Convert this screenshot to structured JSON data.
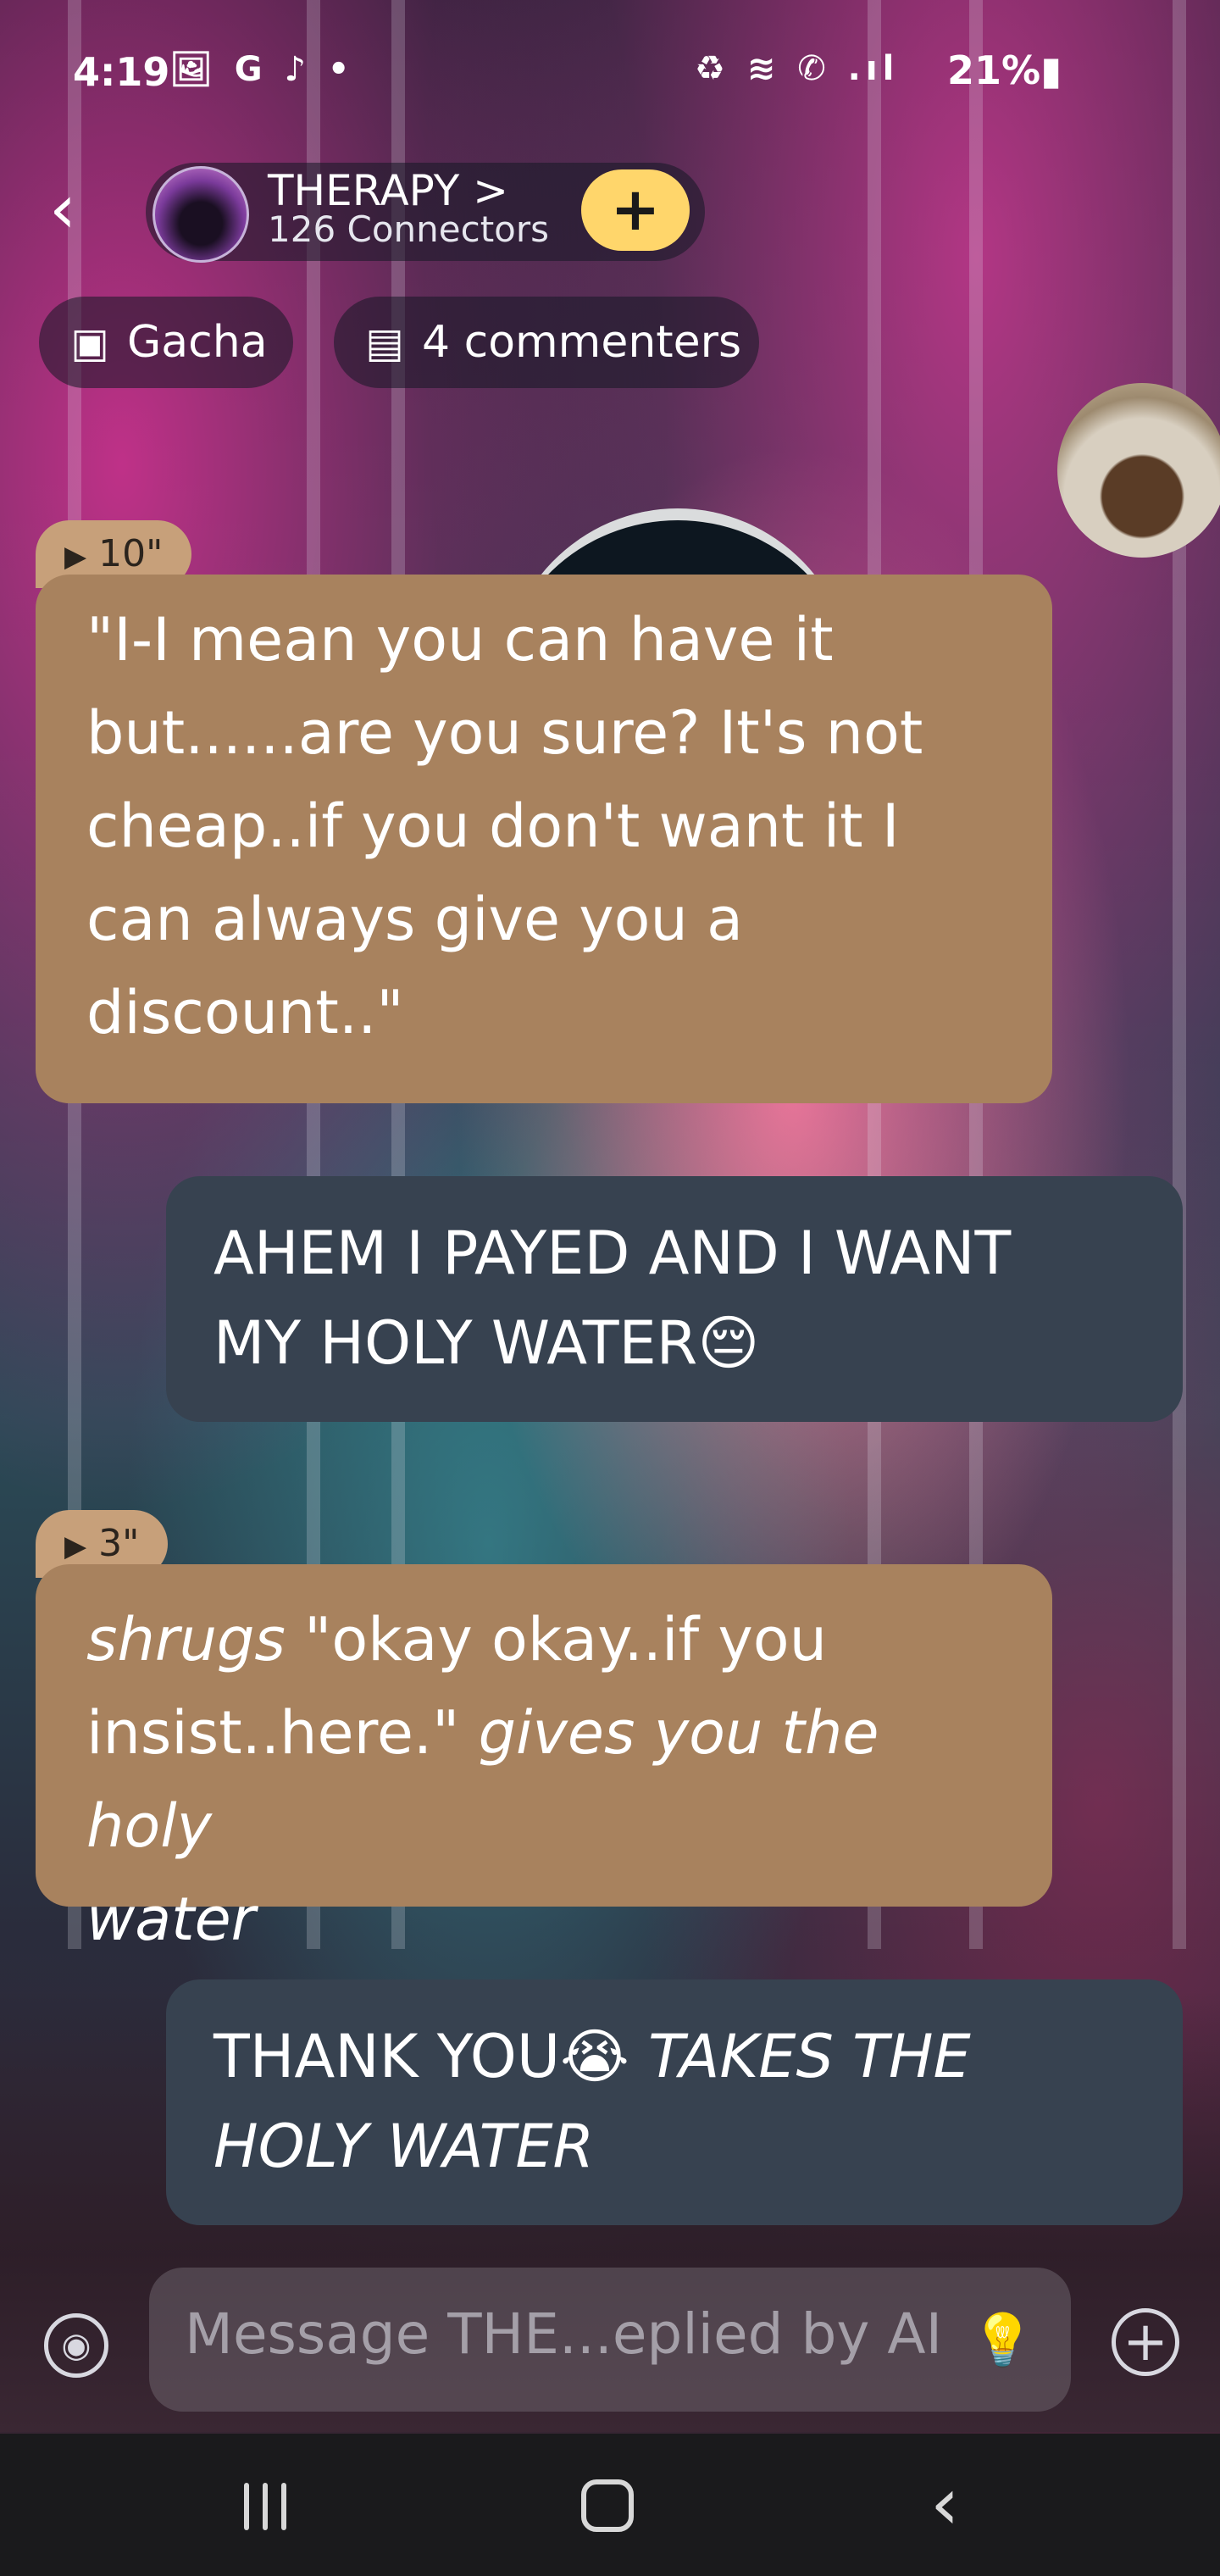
{
  "status_bar": {
    "time": "4:19",
    "left_icons": "🖼 G ♪ •",
    "right_icons": "♻ ≋ ✆ .ıl",
    "battery": "21%▮"
  },
  "header": {
    "back_icon": "‹",
    "group_title": "THERAPY >",
    "group_subtitle": "126 Connectors",
    "join_label": "+"
  },
  "chips": [
    {
      "icon": "▣",
      "label": "Gacha"
    },
    {
      "icon": "▤",
      "label": "4 commenters"
    }
  ],
  "messages": [
    {
      "role": "ai",
      "duration": "10\"",
      "lines": [
        "\"I-I mean you can have it",
        "but......are you sure? It's not",
        "cheap..if you don't want it I",
        "can always give you a",
        "discount..\""
      ]
    },
    {
      "role": "user",
      "lines": [
        "AHEM I PAYED AND I WANT",
        "MY HOLY WATER😔"
      ]
    },
    {
      "role": "ai",
      "duration": "3\"",
      "line1_italic": "shrugs",
      "line1_normal": " \"okay okay..if you",
      "line2_normal": "insist..here.\" ",
      "line2_italic": "gives you the holy",
      "line3_italic": "water"
    },
    {
      "role": "user",
      "line1_normal": "THANK YOU😭 ",
      "line1_italic": "TAKES THE",
      "line2_italic": "HOLY WATER"
    }
  ],
  "composer": {
    "placeholder": "Message THE...eplied by AI",
    "voice_icon": "◉",
    "hint_icon": "💡",
    "add_icon": "+"
  },
  "nav": {
    "back_icon": "‹"
  }
}
